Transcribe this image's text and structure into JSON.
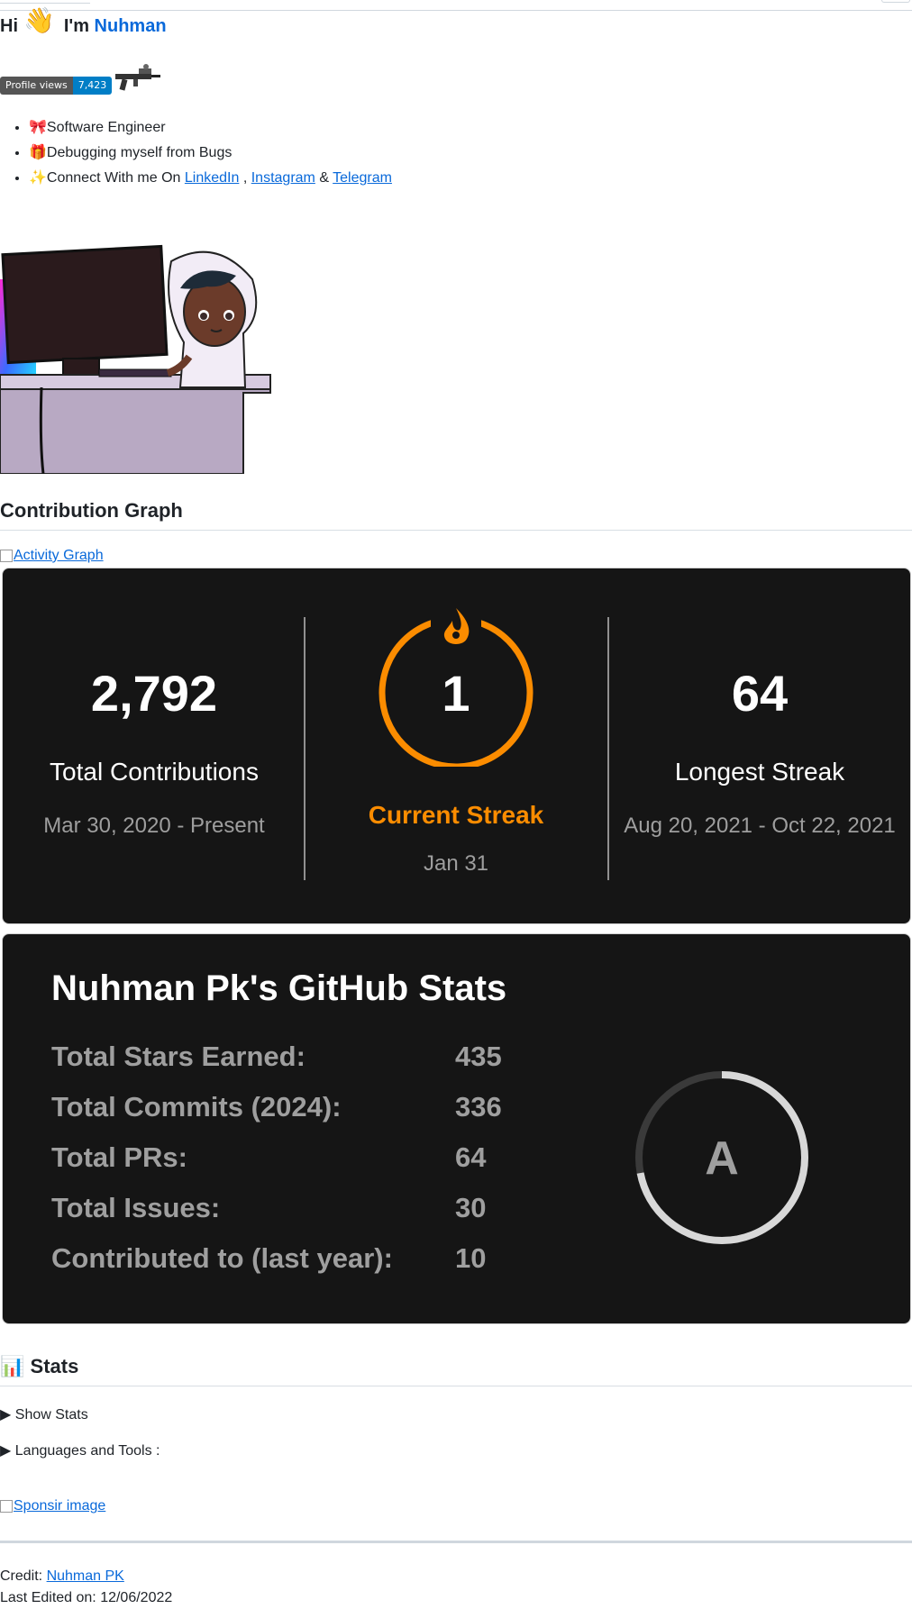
{
  "header": {
    "hi": "Hi",
    "wave": "👋",
    "im": "I'm",
    "name": "Nuhman"
  },
  "badge": {
    "label": "Profile views",
    "value": "7,423"
  },
  "intro": [
    {
      "emoji": "🎀",
      "text": "Software Engineer"
    },
    {
      "emoji": "🎁",
      "text": "Debugging myself from Bugs"
    }
  ],
  "connect": {
    "emoji": "✨",
    "text": "Connect With me On",
    "linkedin": "LinkedIn",
    "sep1": ",",
    "instagram": "Instagram",
    "amp": "&",
    "telegram": "Telegram"
  },
  "contribution": {
    "heading": "Contribution Graph",
    "activity_alt": "Activity Graph"
  },
  "streak": {
    "total": "2,792",
    "total_label": "Total Contributions",
    "total_range": "Mar 30, 2020 - Present",
    "current": "1",
    "current_label": "Current Streak",
    "current_date": "Jan 31",
    "longest": "64",
    "longest_label": "Longest Streak",
    "longest_range": "Aug 20, 2021 - Oct 22, 2021",
    "accent": "#fb8c00"
  },
  "github_stats": {
    "title": "Nuhman Pk's GitHub Stats",
    "rows": [
      {
        "label": "Total Stars Earned:",
        "value": "435"
      },
      {
        "label": "Total Commits (2024):",
        "value": "336"
      },
      {
        "label": "Total PRs:",
        "value": "64"
      },
      {
        "label": "Total Issues:",
        "value": "30"
      },
      {
        "label": "Contributed to (last year):",
        "value": "10"
      }
    ],
    "rank": "A",
    "rank_progress": 0.72
  },
  "stats_section": {
    "emoji": "📊",
    "heading": "Stats",
    "show_stats": "Show Stats",
    "languages": "Languages and Tools :"
  },
  "sponsor_alt": "Sponsir image",
  "footer": {
    "credit_label": "Credit:",
    "credit_link": "Nuhman PK",
    "last_edited": "Last Edited on: 12/06/2022"
  }
}
